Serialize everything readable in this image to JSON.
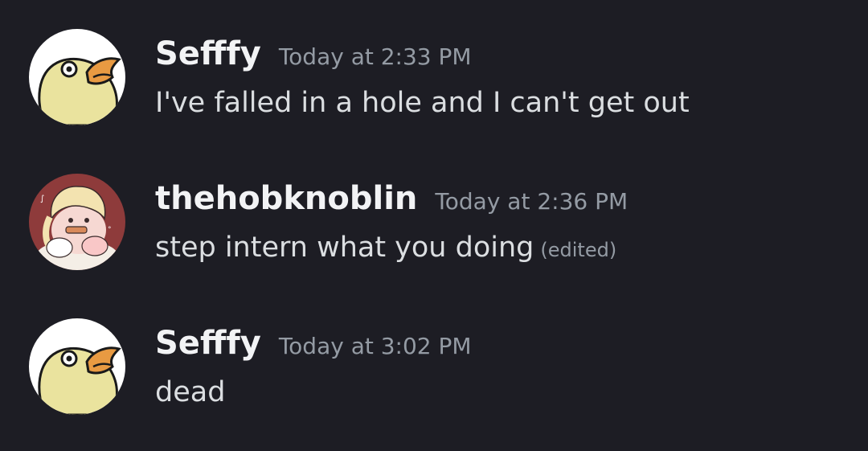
{
  "messages": [
    {
      "avatar_icon": "duck-avatar-icon",
      "username": "Sefffy",
      "timestamp": "Today at 2:33 PM",
      "text": "I've falled in a hole and I can't get out"
    },
    {
      "avatar_icon": "anime-character-avatar-icon",
      "username": "thehobknoblin",
      "timestamp": "Today at 2:36 PM",
      "text": "step intern what you doing",
      "edited_label": "(edited)"
    },
    {
      "avatar_icon": "duck-avatar-icon",
      "username": "Sefffy",
      "timestamp": "Today at 3:02 PM",
      "text": "dead"
    }
  ],
  "colors": {
    "background": "#1d1d24",
    "username": "#f2f3f5",
    "timestamp": "#949ba4",
    "message_text": "#dbdee1",
    "duck_body": "#eae39e",
    "duck_beak": "#e89a42",
    "avatar_red_bg": "#8e3b3b"
  }
}
